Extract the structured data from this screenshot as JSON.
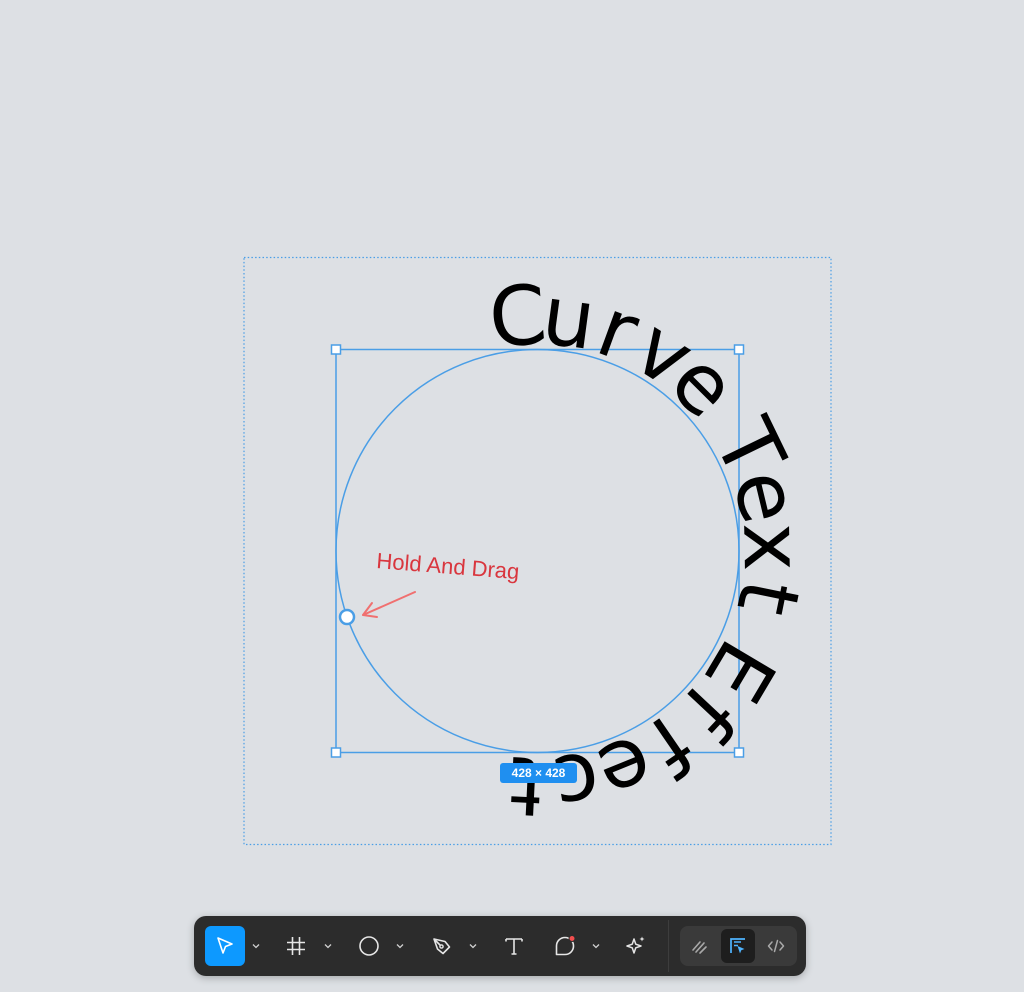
{
  "canvas": {
    "background": "#dde0e4",
    "selection_color": "#4a9ee6",
    "curve_text": "Curve Text Effect",
    "annotation": {
      "label": "Hold And Drag",
      "color": "#d9363e",
      "arrow_color": "#f07070"
    },
    "size_label": "428 × 428",
    "size_label_color": "#1f8ff0"
  },
  "toolbar": {
    "background": "#2c2c2c",
    "accent": "#0d99ff",
    "tools": [
      {
        "icon": "move-icon",
        "active": true,
        "has_menu": true
      },
      {
        "icon": "frame-icon",
        "active": false,
        "has_menu": true
      },
      {
        "icon": "ellipse-icon",
        "active": false,
        "has_menu": true
      },
      {
        "icon": "pen-icon",
        "active": false,
        "has_menu": true
      },
      {
        "icon": "text-icon",
        "active": false,
        "has_menu": false
      },
      {
        "icon": "comment-icon",
        "active": false,
        "has_menu": true
      },
      {
        "icon": "actions-icon",
        "active": false,
        "has_menu": false
      }
    ],
    "modes": [
      {
        "icon": "draw-mode-icon",
        "active": false
      },
      {
        "icon": "design-mode-icon",
        "active": true
      },
      {
        "icon": "dev-mode-icon",
        "active": false
      }
    ]
  }
}
